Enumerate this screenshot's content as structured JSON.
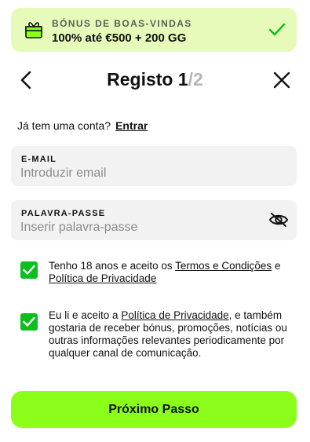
{
  "bonus": {
    "kicker": "BÓNUS DE BOAS-VINDAS",
    "offer": "100% até €500 + 200 GG"
  },
  "header": {
    "title_main": "Registo 1",
    "title_muted": "/2"
  },
  "login": {
    "prompt": "Já tem uma conta?",
    "link": "Entrar"
  },
  "form": {
    "email_label": "E-MAIL",
    "email_placeholder": "Introduzir email",
    "email_value": "",
    "password_label": "PALAVRA-PASSE",
    "password_placeholder": "Inserir palavra-passe",
    "password_value": ""
  },
  "consent_age": {
    "checked": true,
    "prefix": "Tenho 18 anos e aceito os ",
    "terms_link": "Termos e Condições",
    "middle": " e",
    "privacy_link": "Política de Privacidade"
  },
  "consent_marketing": {
    "checked": true,
    "prefix": "Eu li e aceito a ",
    "privacy_link": "Política de Privacidade",
    "suffix": ", e também gostaria de receber bónus, promoções, notícias ou outras informações relevantes periodicamente por qualquer canal de comunicação."
  },
  "actions": {
    "next_label": "Próximo Passo"
  },
  "colors": {
    "accent": "#8bff1a",
    "bonus_bg": "#e6fbb9",
    "checkbox": "#0bbf1e"
  },
  "icons": {
    "gift": "gift-icon",
    "check": "checkmark-icon",
    "back": "chevron-left-icon",
    "close": "close-icon",
    "eye": "eye-slash-icon"
  }
}
